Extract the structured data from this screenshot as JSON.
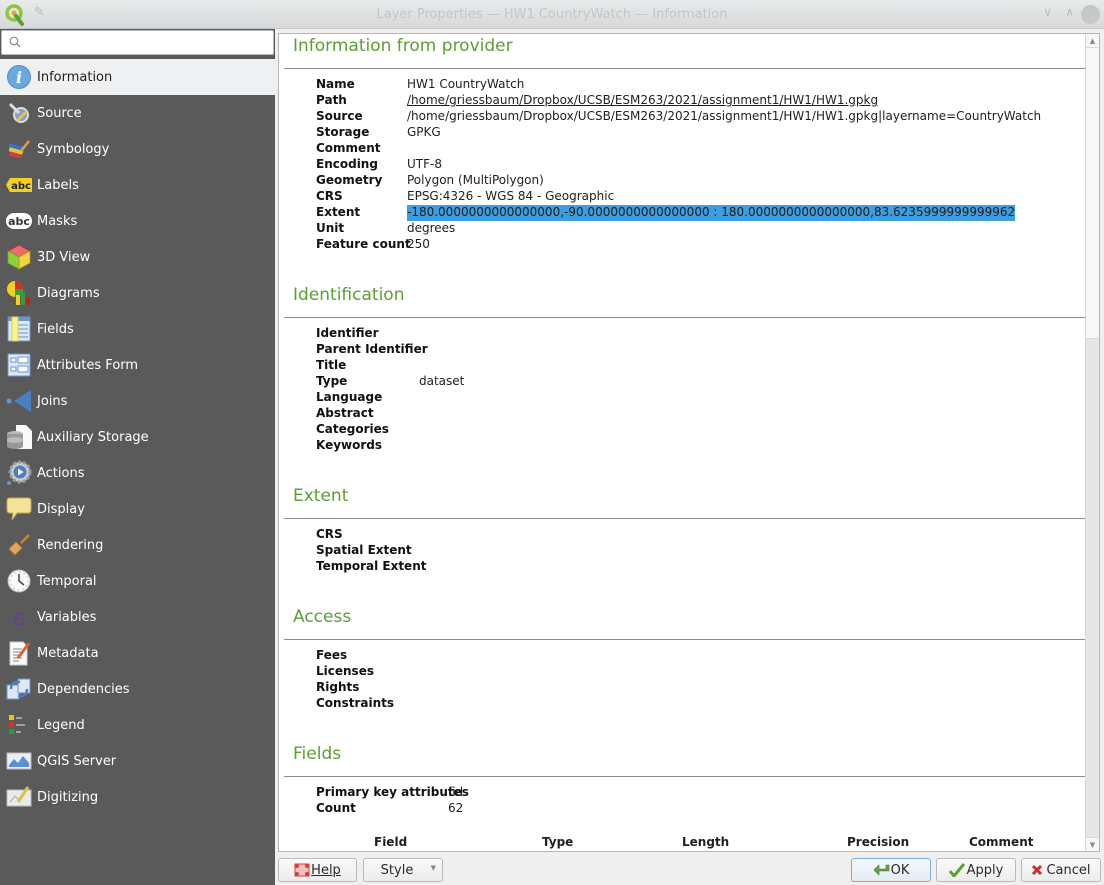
{
  "window": {
    "title": "Layer Properties — HW1 CountryWatch — Information"
  },
  "search": {
    "value": "",
    "placeholder": ""
  },
  "sidebar": {
    "items": [
      {
        "label": "Information",
        "icon": "info-icon",
        "active": true
      },
      {
        "label": "Source",
        "icon": "source-wrench-icon"
      },
      {
        "label": "Symbology",
        "icon": "symbology-brush-icon"
      },
      {
        "label": "Labels",
        "icon": "labels-abc-icon"
      },
      {
        "label": "Masks",
        "icon": "masks-abc-icon"
      },
      {
        "label": "3D View",
        "icon": "3d-cube-icon"
      },
      {
        "label": "Diagrams",
        "icon": "diagrams-chart-icon"
      },
      {
        "label": "Fields",
        "icon": "fields-table-icon"
      },
      {
        "label": "Attributes Form",
        "icon": "attributes-form-icon"
      },
      {
        "label": "Joins",
        "icon": "joins-icon"
      },
      {
        "label": "Auxiliary Storage",
        "icon": "auxiliary-storage-icon"
      },
      {
        "label": "Actions",
        "icon": "actions-gear-icon"
      },
      {
        "label": "Display",
        "icon": "display-speech-bubble-icon"
      },
      {
        "label": "Rendering",
        "icon": "rendering-brush-icon"
      },
      {
        "label": "Temporal",
        "icon": "temporal-clock-icon"
      },
      {
        "label": "Variables",
        "icon": "variables-epsilon-icon"
      },
      {
        "label": "Metadata",
        "icon": "metadata-document-icon"
      },
      {
        "label": "Dependencies",
        "icon": "dependencies-icon"
      },
      {
        "label": "Legend",
        "icon": "legend-icon"
      },
      {
        "label": "QGIS Server",
        "icon": "qgis-server-map-icon"
      },
      {
        "label": "Digitizing",
        "icon": "digitizing-icon"
      }
    ]
  },
  "content": {
    "provider": {
      "title": "Information from provider",
      "rows": [
        {
          "key": "Name",
          "value": "HW1 CountryWatch"
        },
        {
          "key": "Path",
          "value": "/home/griessbaum/Dropbox/UCSB/ESM263/2021/assignment1/HW1/HW1.gpkg",
          "link": true
        },
        {
          "key": "Source",
          "value": "/home/griessbaum/Dropbox/UCSB/ESM263/2021/assignment1/HW1/HW1.gpkg|layername=CountryWatch"
        },
        {
          "key": "Storage",
          "value": "GPKG"
        },
        {
          "key": "Comment",
          "value": ""
        },
        {
          "key": "Encoding",
          "value": "UTF-8"
        },
        {
          "key": "Geometry",
          "value": "Polygon (MultiPolygon)"
        },
        {
          "key": "CRS",
          "value": "EPSG:4326 - WGS 84 - Geographic"
        },
        {
          "key": "Extent",
          "value": "-180.0000000000000000,-90.0000000000000000 : 180.0000000000000000,83.6235999999999962",
          "selected": true
        },
        {
          "key": "Unit",
          "value": "degrees"
        },
        {
          "key": "Feature count",
          "value": "250"
        }
      ]
    },
    "identification": {
      "title": "Identification",
      "rows": [
        {
          "key": "Identifier",
          "value": ""
        },
        {
          "key": "Parent Identifier",
          "value": ""
        },
        {
          "key": "Title",
          "value": ""
        },
        {
          "key": "Type",
          "value": "dataset"
        },
        {
          "key": "Language",
          "value": ""
        },
        {
          "key": "Abstract",
          "value": ""
        },
        {
          "key": "Categories",
          "value": ""
        },
        {
          "key": "Keywords",
          "value": ""
        }
      ]
    },
    "extent": {
      "title": "Extent",
      "rows": [
        {
          "key": "CRS",
          "value": ""
        },
        {
          "key": "Spatial Extent",
          "value": ""
        },
        {
          "key": "Temporal Extent",
          "value": ""
        }
      ]
    },
    "access": {
      "title": "Access",
      "rows": [
        {
          "key": "Fees",
          "value": ""
        },
        {
          "key": "Licenses",
          "value": ""
        },
        {
          "key": "Rights",
          "value": ""
        },
        {
          "key": "Constraints",
          "value": ""
        }
      ]
    },
    "fields": {
      "title": "Fields",
      "rows": [
        {
          "key": "Primary key attributes",
          "value": "fid"
        },
        {
          "key": "Count",
          "value": "62"
        }
      ],
      "table_headers": [
        "Field",
        "Type",
        "Length",
        "Precision",
        "Comment"
      ]
    }
  },
  "scroll": {
    "position_fraction": 0.0,
    "visible_fraction": 0.37
  },
  "buttons": {
    "help": "Help",
    "style": "Style",
    "ok": "OK",
    "apply": "Apply",
    "cancel": "Cancel"
  }
}
